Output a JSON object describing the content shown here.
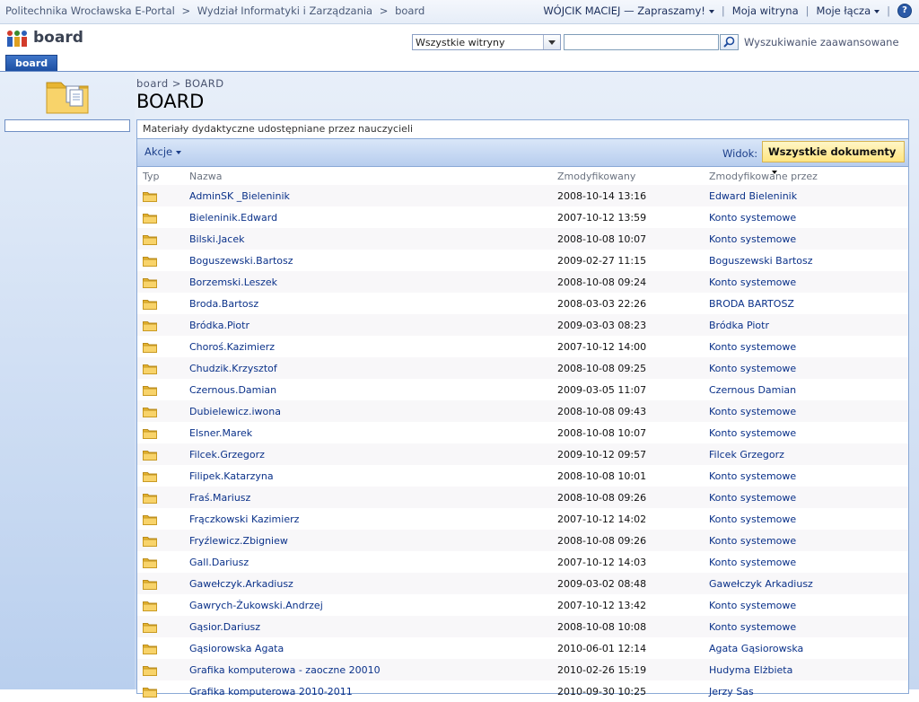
{
  "global_breadcrumb": [
    "Politechnika Wrocławska E-Portal",
    "Wydział Informatyki i Zarządzania",
    "board"
  ],
  "global_breadcrumb_sep": ">",
  "global_nav": {
    "user": "WÓJCIK MACIEJ — Zapraszamy!",
    "my_site": "Moja witryna",
    "my_links": "Moje łącza",
    "help_icon": "?"
  },
  "site": {
    "title": "board",
    "logo": "site-logo-icon"
  },
  "search": {
    "scope": "Wszystkie witryny",
    "query": "",
    "advanced": "Wyszukiwanie zaawansowane"
  },
  "tabs": [
    {
      "label": "board",
      "selected": true
    }
  ],
  "page": {
    "breadcrumb": [
      "board",
      "BOARD"
    ],
    "breadcrumb_sep": ">",
    "title": "BOARD",
    "description": "Materiały dydaktyczne udostępniane przez nauczycieli"
  },
  "toolbar": {
    "actions": "Akcje",
    "view_label": "Widok:",
    "view_value": "Wszystkie dokumenty"
  },
  "columns": {
    "type": "Typ",
    "name": "Nazwa",
    "modified": "Zmodyfikowany",
    "modified_by": "Zmodyfikowane przez"
  },
  "rows": [
    {
      "name": "AdminSK _Bieleninik",
      "modified": "2008-10-14 13:16",
      "by": "Edward Bieleninik"
    },
    {
      "name": "Bieleninik.Edward",
      "modified": "2007-10-12 13:59",
      "by": "Konto systemowe"
    },
    {
      "name": "Bilski.Jacek",
      "modified": "2008-10-08 10:07",
      "by": "Konto systemowe"
    },
    {
      "name": "Boguszewski.Bartosz",
      "modified": "2009-02-27 11:15",
      "by": "Boguszewski Bartosz"
    },
    {
      "name": "Borzemski.Leszek",
      "modified": "2008-10-08 09:24",
      "by": "Konto systemowe"
    },
    {
      "name": "Broda.Bartosz",
      "modified": "2008-03-03 22:26",
      "by": "BRODA BARTOSZ"
    },
    {
      "name": "Bródka.Piotr",
      "modified": "2009-03-03 08:23",
      "by": "Bródka Piotr"
    },
    {
      "name": "Choroś.Kazimierz",
      "modified": "2007-10-12 14:00",
      "by": "Konto systemowe"
    },
    {
      "name": "Chudzik.Krzysztof",
      "modified": "2008-10-08 09:25",
      "by": "Konto systemowe"
    },
    {
      "name": "Czernous.Damian",
      "modified": "2009-03-05 11:07",
      "by": "Czernous Damian"
    },
    {
      "name": "Dubielewicz.iwona",
      "modified": "2008-10-08 09:43",
      "by": "Konto systemowe"
    },
    {
      "name": "Elsner.Marek",
      "modified": "2008-10-08 10:07",
      "by": "Konto systemowe"
    },
    {
      "name": "Filcek.Grzegorz",
      "modified": "2009-10-12 09:57",
      "by": "Filcek Grzegorz"
    },
    {
      "name": "Filipek.Katarzyna",
      "modified": "2008-10-08 10:01",
      "by": "Konto systemowe"
    },
    {
      "name": "Fraś.Mariusz",
      "modified": "2008-10-08 09:26",
      "by": "Konto systemowe"
    },
    {
      "name": "Frączkowski Kazimierz",
      "modified": "2007-10-12 14:02",
      "by": "Konto systemowe"
    },
    {
      "name": "Fryźlewicz.Zbigniew",
      "modified": "2008-10-08 09:26",
      "by": "Konto systemowe"
    },
    {
      "name": "Gall.Dariusz",
      "modified": "2007-10-12 14:03",
      "by": "Konto systemowe"
    },
    {
      "name": "Gawełczyk.Arkadiusz",
      "modified": "2009-03-02 08:48",
      "by": "Gawełczyk Arkadiusz"
    },
    {
      "name": "Gawrych-Żukowski.Andrzej",
      "modified": "2007-10-12 13:42",
      "by": "Konto systemowe"
    },
    {
      "name": "Gąsior.Dariusz",
      "modified": "2008-10-08 10:08",
      "by": "Konto systemowe"
    },
    {
      "name": "Gąsiorowska Agata",
      "modified": "2010-06-01 12:14",
      "by": "Agata Gąsiorowska"
    },
    {
      "name": "Grafika komputerowa - zaoczne 20010",
      "modified": "2010-02-26 15:19",
      "by": "Hudyma Elżbieta"
    },
    {
      "name": "Grafika komputerowa 2010-2011",
      "modified": "2010-09-30 10:25",
      "by": "Jerzy Sas"
    }
  ],
  "colors": {
    "link": "#0a3189",
    "tab": "#2a5db0",
    "view_highlight": "#ffe580"
  }
}
